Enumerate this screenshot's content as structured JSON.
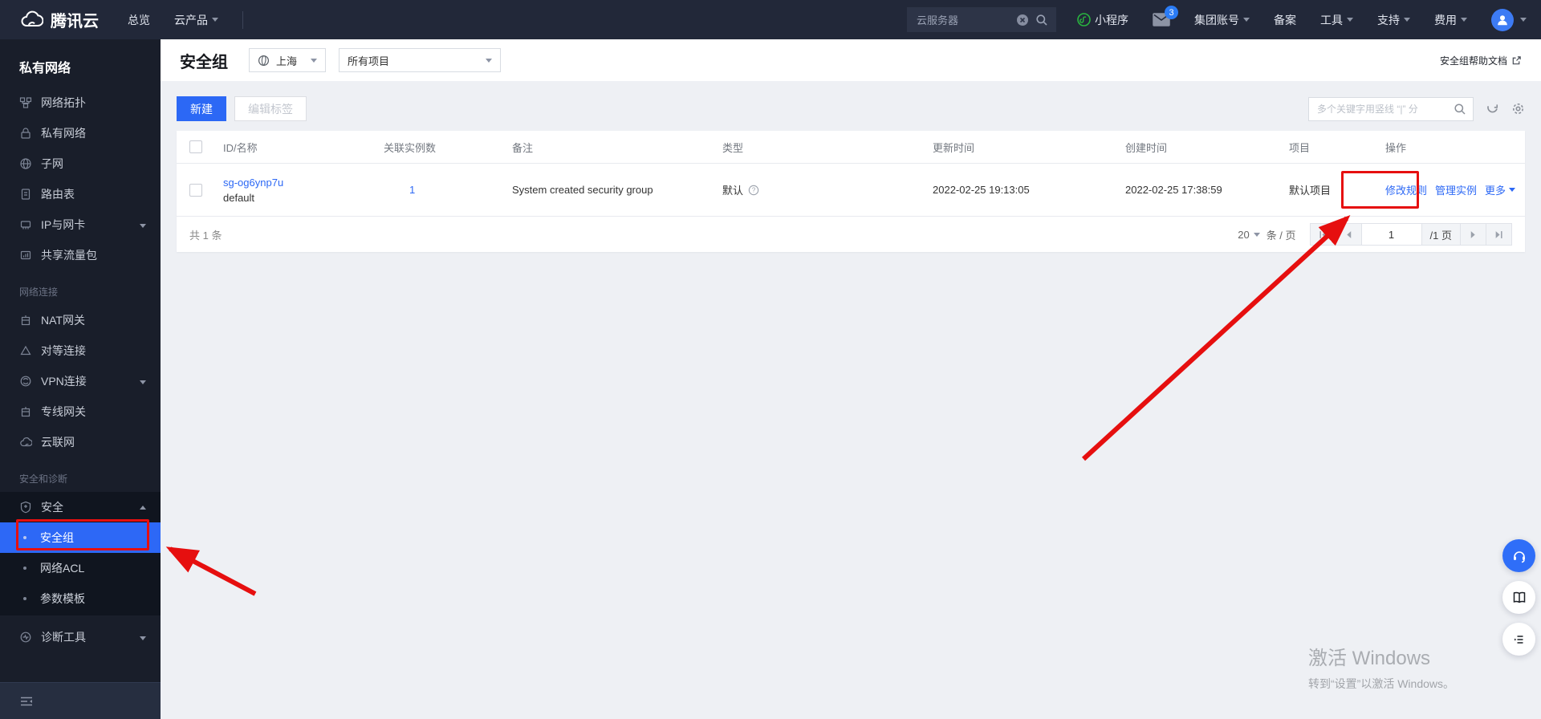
{
  "topnav": {
    "brand": "腾讯云",
    "overview": "总览",
    "products": "云产品",
    "search_value": "云服务器",
    "miniprogram": "小程序",
    "mail_badge": "3",
    "group_account": "集团账号",
    "beian": "备案",
    "tools": "工具",
    "support": "支持",
    "billing": "费用"
  },
  "sidebar": {
    "title": "私有网络",
    "items": [
      {
        "label": "网络拓扑"
      },
      {
        "label": "私有网络"
      },
      {
        "label": "子网"
      },
      {
        "label": "路由表"
      },
      {
        "label": "IP与网卡"
      },
      {
        "label": "共享流量包"
      }
    ],
    "section_network": "网络连接",
    "network_items": [
      {
        "label": "NAT网关"
      },
      {
        "label": "对等连接"
      },
      {
        "label": "VPN连接"
      },
      {
        "label": "专线网关"
      },
      {
        "label": "云联网"
      }
    ],
    "section_security": "安全和诊断",
    "security": "安全",
    "security_children": [
      {
        "label": "安全组"
      },
      {
        "label": "网络ACL"
      },
      {
        "label": "参数模板"
      }
    ],
    "diagnostic": "诊断工具"
  },
  "header": {
    "title": "安全组",
    "region": "上海",
    "project": "所有项目",
    "help_doc": "安全组帮助文档"
  },
  "toolbar": {
    "create": "新建",
    "edit_tags": "编辑标签",
    "search_placeholder": "多个关键字用竖线 “|” 分"
  },
  "table": {
    "columns": {
      "id": "ID/名称",
      "instances": "关联实例数",
      "remark": "备注",
      "type": "类型",
      "updated": "更新时间",
      "created": "创建时间",
      "project": "项目",
      "action": "操作"
    },
    "row": {
      "id": "sg-og6ynp7u",
      "name": "default",
      "instances": "1",
      "remark": "System created security group",
      "type": "默认",
      "updated": "2022-02-25 19:13:05",
      "created": "2022-02-25 17:38:59",
      "project": "默认项目",
      "action_modify": "修改规则",
      "action_manage": "管理实例",
      "action_more": "更多"
    }
  },
  "pagination": {
    "total": "共 1 条",
    "page_size": "20",
    "per_page": "条 / 页",
    "current_page": "1",
    "page_count": "/1 页"
  },
  "watermark": {
    "line1": "激活 Windows",
    "line2": "转到“设置”以激活 Windows。"
  }
}
